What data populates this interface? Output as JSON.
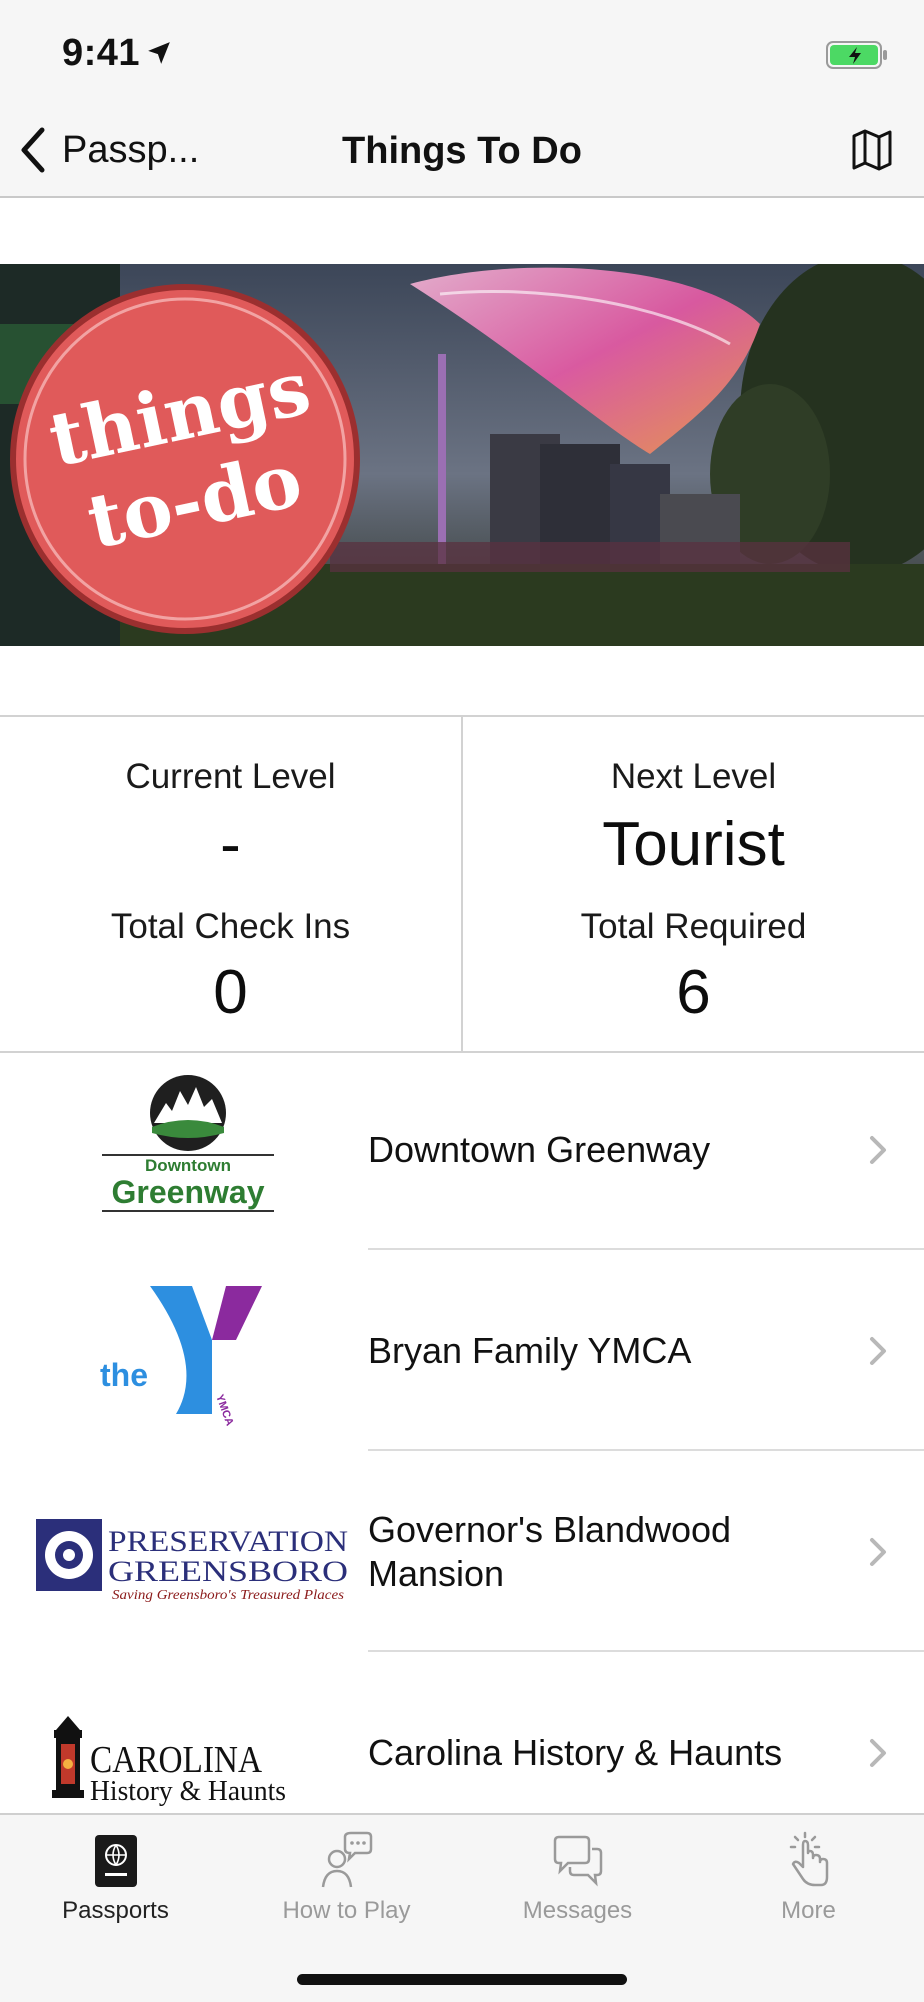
{
  "status_bar": {
    "time": "9:41"
  },
  "nav": {
    "back_label": "Passp...",
    "title": "Things To Do"
  },
  "hero": {
    "badge_line1": "things",
    "badge_line2": "to-do"
  },
  "stats": {
    "current_level_label": "Current Level",
    "current_level_value": "-",
    "total_checkins_label": "Total Check Ins",
    "total_checkins_value": "0",
    "next_level_label": "Next Level",
    "next_level_value": "Tourist",
    "total_required_label": "Total Required",
    "total_required_value": "6"
  },
  "items": [
    {
      "label": "Downtown Greenway",
      "logo_line1": "Downtown",
      "logo_line2": "Greenway"
    },
    {
      "label": "Bryan Family YMCA",
      "logo_line1": "the",
      "logo_line2": "YMCA"
    },
    {
      "label": "Governor's Blandwood Mansion",
      "logo_line1": "PRESERVATION",
      "logo_line2": "GREENSBORO",
      "logo_line3": "Saving Greensboro's Treasured Places"
    },
    {
      "label": "Carolina History & Haunts",
      "logo_line1": "CAROLINA",
      "logo_line2": "History & Haunts"
    }
  ],
  "tabs": [
    {
      "label": "Passports",
      "icon": "passport-icon",
      "active": true
    },
    {
      "label": "How to Play",
      "icon": "how-to-play-icon",
      "active": false
    },
    {
      "label": "Messages",
      "icon": "messages-icon",
      "active": false
    },
    {
      "label": "More",
      "icon": "more-icon",
      "active": false
    }
  ],
  "colors": {
    "badge_red": "#e05a5a",
    "greenway_green": "#2e7d32",
    "ymca_blue": "#2d8fe0",
    "ymca_purple": "#8b2a9e",
    "preservation_navy": "#2b2f7a",
    "preservation_red": "#8b1a1a",
    "battery_green": "#4cd964"
  }
}
